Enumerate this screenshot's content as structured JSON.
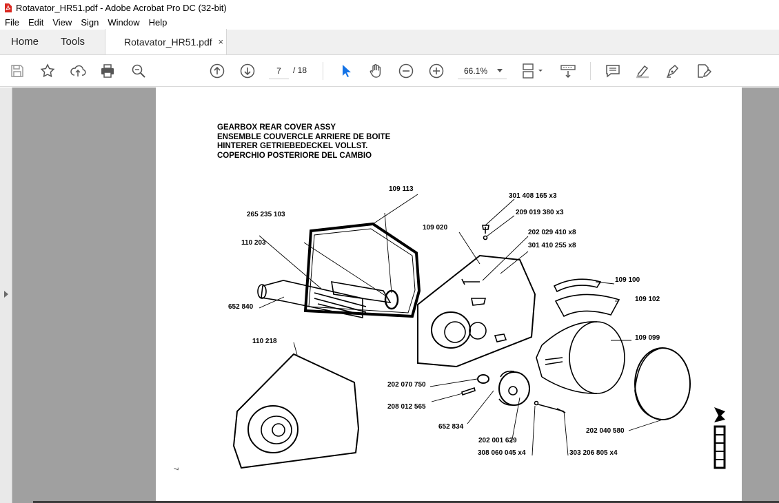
{
  "window": {
    "title": "Rotavator_HR51.pdf - Adobe Acrobat Pro DC (32-bit)"
  },
  "menu": [
    "File",
    "Edit",
    "View",
    "Sign",
    "Window",
    "Help"
  ],
  "tabs": {
    "home": "Home",
    "tools": "Tools",
    "document": "Rotavator_HR51.pdf",
    "close": "×"
  },
  "toolbar": {
    "current_page": "7",
    "total_pages": "/ 18",
    "zoom": "66.1%",
    "icons": [
      "save-icon",
      "bookmark-star-icon",
      "cloud-upload-icon",
      "print-icon",
      "search-zoom-icon",
      "page-up-icon",
      "page-down-icon",
      "select-cursor-icon",
      "hand-tool-icon",
      "zoom-out-icon",
      "zoom-in-icon",
      "page-layout-icon",
      "scroll-mode-icon",
      "comment-icon",
      "highlight-pen-icon",
      "fill-sign-icon",
      "edit-pdf-icon"
    ]
  },
  "document": {
    "heading": [
      "GEARBOX REAR COVER ASSY",
      "ENSEMBLE COUVERCLE ARRIERE DE BOITE",
      "HINTERER GETRIEBEDECKEL VOLLST.",
      "COPERCHIO POSTERIORE DEL CAMBIO"
    ],
    "page_number": "7",
    "part_labels": [
      "109 113",
      "301 408 165 x3",
      "265 235 103",
      "209 019 380 x3",
      "109 020",
      "202 029 410 x8",
      "110 203",
      "301 410 255 x8",
      "109 100",
      "109 102",
      "652 840",
      "109 099",
      "110 218",
      "202 070 750",
      "208 012 565",
      "652 834",
      "202 001 629",
      "202 040 580",
      "308 060 045 x4",
      "303 206 805 x4"
    ]
  }
}
